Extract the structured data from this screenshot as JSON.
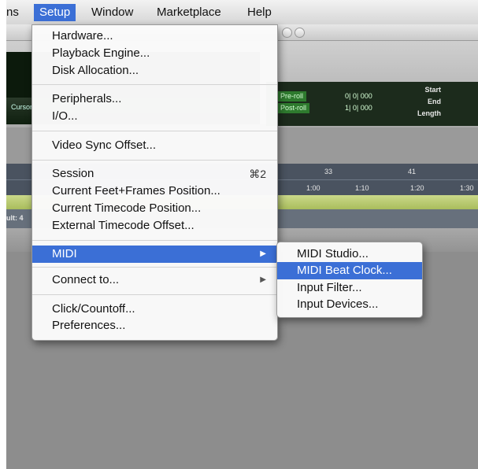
{
  "menubar": {
    "items": [
      "ns",
      "Setup",
      "Window",
      "Marketplace",
      "Help"
    ]
  },
  "transport": {
    "buttons": [
      "◐",
      "⏮",
      "⏪",
      "⏩",
      "⏭",
      "■"
    ],
    "preroll_label": "Pre-roll",
    "postroll_label": "Post-roll",
    "preroll_value": "0| 0| 000",
    "postroll_value": "1| 0| 000",
    "selection_labels": [
      "Start",
      "End",
      "Length"
    ],
    "cursor_label": "Cursor"
  },
  "ruler": {
    "bars": [
      "33",
      "41"
    ],
    "times": [
      "1:00",
      "1:10",
      "1:20",
      "1:30"
    ]
  },
  "track": {
    "label": "ult: 4"
  },
  "setup_menu": {
    "items": [
      {
        "label": "Hardware..."
      },
      {
        "label": "Playback Engine..."
      },
      {
        "label": "Disk Allocation..."
      },
      {
        "label": "Peripherals..."
      },
      {
        "label": "I/O..."
      },
      {
        "label": "Video Sync Offset..."
      },
      {
        "label": "Session",
        "shortcut": "⌘2"
      },
      {
        "label": "Current Feet+Frames Position..."
      },
      {
        "label": "Current Timecode Position..."
      },
      {
        "label": "External Timecode Offset..."
      },
      {
        "label": "MIDI"
      },
      {
        "label": "Connect to..."
      },
      {
        "label": "Click/Countoff..."
      },
      {
        "label": "Preferences..."
      }
    ]
  },
  "midi_submenu": {
    "items": [
      {
        "label": "MIDI Studio..."
      },
      {
        "label": "MIDI Beat Clock..."
      },
      {
        "label": "Input Filter..."
      },
      {
        "label": "Input Devices..."
      }
    ]
  },
  "colors": {
    "menu_highlight": "#3b6fd6",
    "counter_bg": "#0c1a0c",
    "track_green": "#b6c86e",
    "ruler": "#4a5360"
  }
}
